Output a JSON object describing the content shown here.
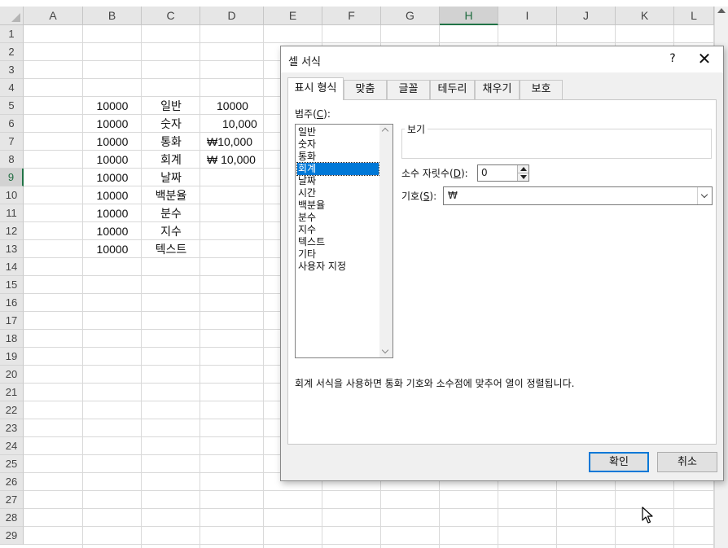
{
  "spreadsheet": {
    "columns": [
      "A",
      "B",
      "C",
      "D",
      "E",
      "F",
      "G",
      "H",
      "I",
      "J",
      "K",
      "L"
    ],
    "selected_column": "H",
    "rows": [
      "1",
      "2",
      "3",
      "4",
      "5",
      "6",
      "7",
      "8",
      "9",
      "10",
      "11",
      "12",
      "13",
      "14",
      "15",
      "16",
      "17",
      "18",
      "19",
      "20",
      "21",
      "22",
      "23",
      "24",
      "25",
      "26",
      "27",
      "28",
      "29"
    ],
    "selected_row": "9",
    "data_rows": [
      {
        "row": "5",
        "b": "10000",
        "c": "일반",
        "d": "10000"
      },
      {
        "row": "6",
        "b": "10000",
        "c": "숫자",
        "d": "10,000"
      },
      {
        "row": "7",
        "b": "10000",
        "c": "통화",
        "d": "₩10,000"
      },
      {
        "row": "8",
        "b": "10000",
        "c": "회계",
        "d": "₩ 10,000"
      },
      {
        "row": "9",
        "b": "10000",
        "c": "날짜",
        "d": ""
      },
      {
        "row": "10",
        "b": "10000",
        "c": "백분율",
        "d": ""
      },
      {
        "row": "11",
        "b": "10000",
        "c": "분수",
        "d": ""
      },
      {
        "row": "12",
        "b": "10000",
        "c": "지수",
        "d": ""
      },
      {
        "row": "13",
        "b": "10000",
        "c": "텍스트",
        "d": ""
      }
    ]
  },
  "dialog": {
    "title": "셀 서식",
    "help": "?",
    "close": "✕",
    "tabs": [
      "표시 형식",
      "맞춤",
      "글꼴",
      "테두리",
      "채우기",
      "보호"
    ],
    "active_tab": "표시 형식",
    "category_label": "범주(C):",
    "category_label_text": "범주(",
    "category_label_key": "C",
    "category_label_end": "):",
    "categories": [
      "일반",
      "숫자",
      "통화",
      "회계",
      "날짜",
      "시간",
      "백분율",
      "분수",
      "지수",
      "텍스트",
      "기타",
      "사용자 지정"
    ],
    "selected_category": "회계",
    "preview_label": "보기",
    "preview_value": "",
    "decimal_label_text": "소수 자릿수(",
    "decimal_label_key": "D",
    "decimal_label_end": "):",
    "decimal_value": "0",
    "symbol_label_text": "기호(",
    "symbol_label_key": "S",
    "symbol_label_end": "):",
    "symbol_value": "₩",
    "description": "회계 서식을 사용하면 통화 기호와 소수점에 맞추어 열이 정렬됩니다.",
    "ok_label": "확인",
    "cancel_label": "취소"
  },
  "colors": {
    "accent": "#0078d7",
    "excel_green": "#217346"
  }
}
